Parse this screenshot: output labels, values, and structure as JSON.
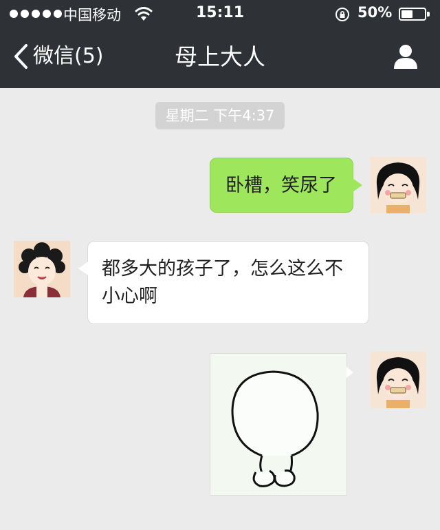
{
  "status_bar": {
    "carrier": "中国移动",
    "time": "15:11",
    "battery": "50%",
    "battery_level": 0.5
  },
  "nav": {
    "back_label": "微信(5)",
    "title": "母上大人"
  },
  "timestamp": "星期二 下午4:37",
  "messages": [
    {
      "sender": "me",
      "text": "卧槽，笑尿了"
    },
    {
      "sender": "mom",
      "text_line1": "都多大的孩子了，怎么这么不",
      "text_line2": "小心啊"
    },
    {
      "sender": "me",
      "type": "sticker"
    }
  ],
  "colors": {
    "bar_bg": "#2e3136",
    "chat_bg": "#ebebeb",
    "my_bubble": "#9ee65c",
    "their_bubble": "#ffffff"
  },
  "icons": [
    "signal-dots",
    "wifi-icon",
    "rotation-lock-icon",
    "battery-icon",
    "back-chevron-icon",
    "profile-icon"
  ]
}
